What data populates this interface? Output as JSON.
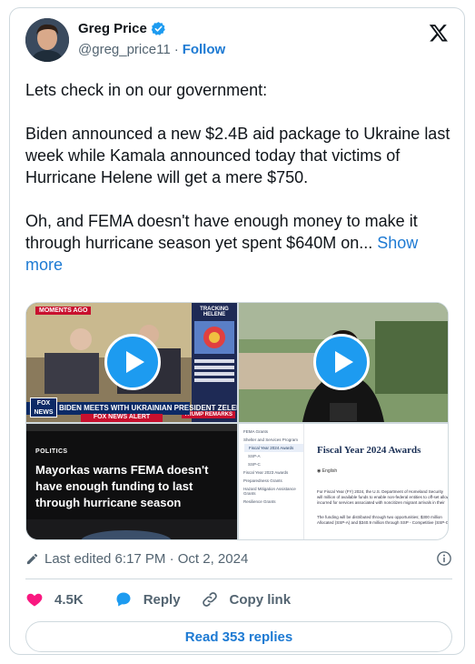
{
  "author": {
    "name": "Greg Price",
    "handle": "@greg_price11",
    "separator": "·",
    "follow_label": "Follow"
  },
  "tweet": {
    "text": "Lets check in on our government:\n\nBiden announced a new $2.4B aid package to Ukraine last week while Kamala announced today that victims of Hurricane Helene will get a mere $750.\n\nOh, and FEMA doesn't have enough money to make it through hurricane season yet spent $640M on...",
    "show_more_label": "Show more"
  },
  "media": {
    "video1": {
      "moments_tag": "MOMENTS AGO",
      "banner": "BIDEN MEETS WITH UKRAINIAN PRESIDENT ZELENSKYY",
      "alert": "FOX NEWS ALERT",
      "logo": "FOX NEWS",
      "side_panel": "TRACKING HELENE",
      "corner_box": "TRUMP REMARKS"
    },
    "image3": {
      "section": "POLITICS",
      "headline": "Mayorkas warns FEMA doesn't have enough funding to last through hurricane season"
    },
    "image4": {
      "sidebar_items": [
        "FEMA Grants",
        "Shelter and Services Program",
        "Fiscal Year 2024 Awards",
        "SSP-A",
        "SSP-C",
        "Fiscal Year 2023 Awards",
        "Preparedness Grants",
        "Hazard Mitigation Assistance Grants",
        "Resilience Grants"
      ],
      "title": "Fiscal Year 2024 Awards",
      "language": "English",
      "paragraph1": "For Fiscal Year (FY) 2024, the U.S. Department of Homeland Security will million of available funds to enable non-federal entities to off-set allow incurred for services associated with noncitizen migrant arrivals in their",
      "paragraph2": "The funding will be distributed through two opportunities; $300 million Allocated (SSP-A) and $340.9 million through SSP - Competitive (SSP-C"
    }
  },
  "meta": {
    "edited": "Last edited 6:17 PM · Oct 2, 2024"
  },
  "actions": {
    "likes": "4.5K",
    "reply_label": "Reply",
    "copy_link_label": "Copy link"
  },
  "read_replies_label": "Read 353 replies",
  "colors": {
    "accent": "#1d9bf0",
    "link": "#1d7ad3",
    "like": "#f91880",
    "text": "#0f1419",
    "muted": "#536471",
    "border": "#cfd9de"
  }
}
